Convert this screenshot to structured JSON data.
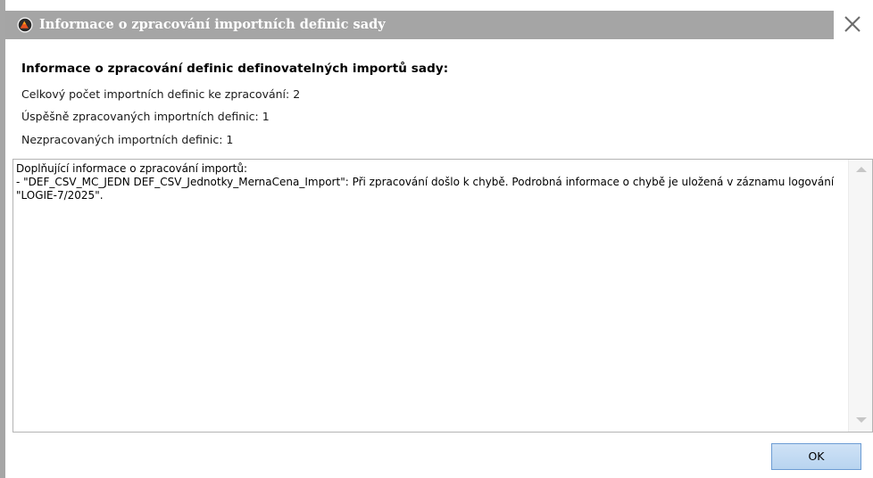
{
  "window": {
    "title": "Informace o zpracování importních definic sady",
    "app_icon": "app-logo-icon",
    "close_icon": "close-icon"
  },
  "content": {
    "heading": "Informace o zpracování definic definovatelných importů sady:",
    "total_line": "Celkový počet importních definic ke zpracování: 2",
    "success_line": "Úspěšně zpracovaných importních definic: 1",
    "failed_line": "Nezpracovaných importních definic: 1"
  },
  "details": {
    "text": "Doplňující informace o zpracování importů:\n- \"DEF_CSV_MC_JEDN DEF_CSV_Jednotky_MernaCena_Import\": Při zpracování došlo k chybě. Podrobná informace o chybě je uložená v záznamu logování \"LOGIE-7/2025\"."
  },
  "buttons": {
    "ok_label": "OK"
  },
  "colors": {
    "title_bar": "#a5a5a5",
    "ok_button_fill": "#c6dcf3",
    "ok_button_border": "#6c9cd4"
  }
}
